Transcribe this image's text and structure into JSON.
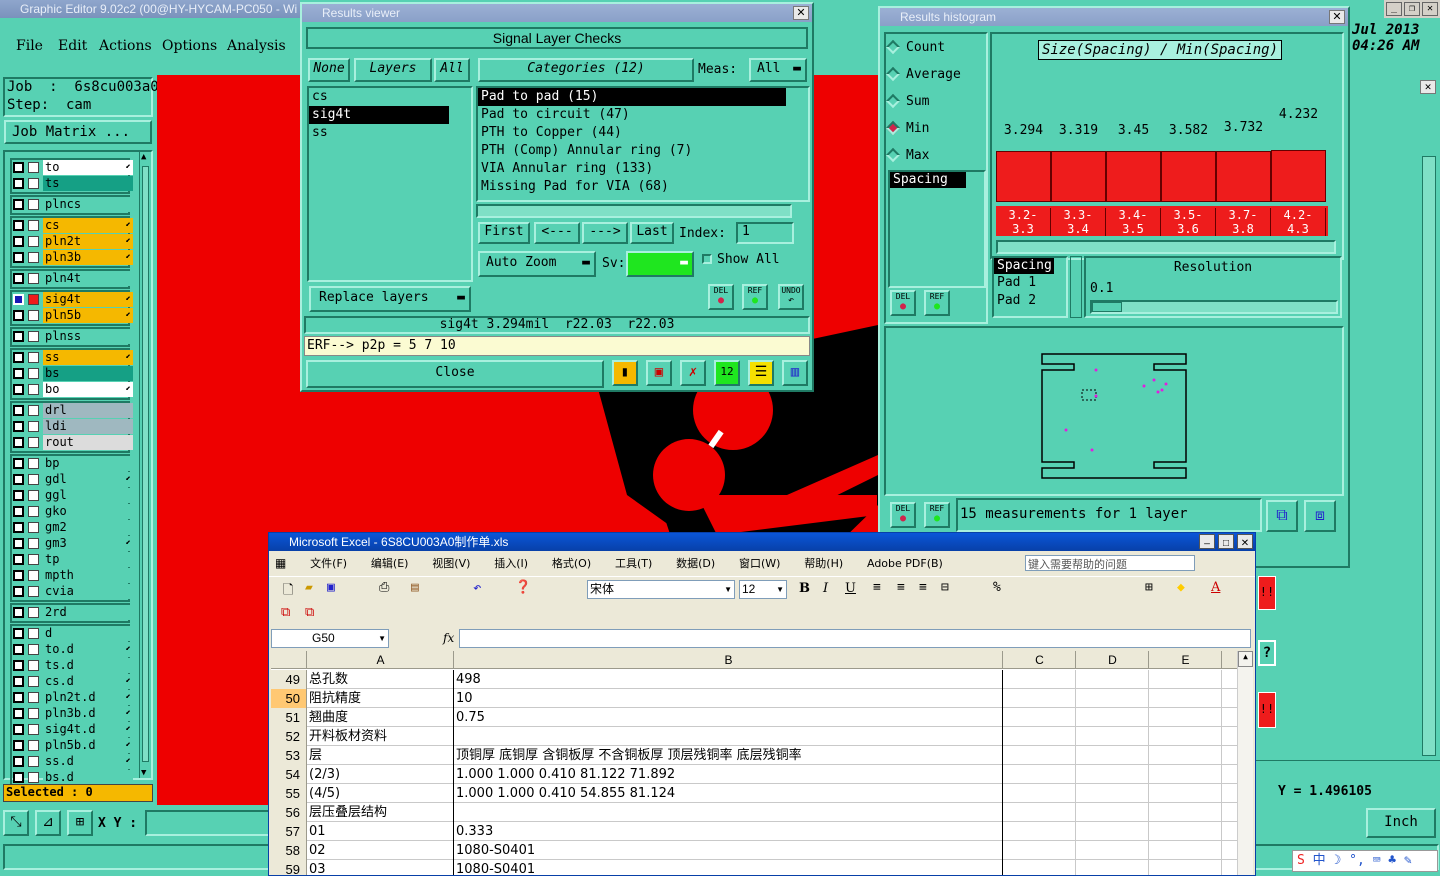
{
  "app": {
    "title": "Graphic Editor 9.02c2 (00@HY-HYCAM-PC050 - Wi",
    "datetime": "Jul 2013",
    "time": "04:26 AM",
    "menu": [
      "File",
      "Edit",
      "Actions",
      "Options",
      "Analysis"
    ],
    "job_label": "Job  :  6s8cu003a0",
    "step_label": "Step:  cam",
    "job_matrix": "Job Matrix ...",
    "selected": "Selected : 0",
    "xy_label": "X Y :",
    "units": "Inch",
    "coord_readout": "Y = 1.496105",
    "layers": [
      {
        "name": "to",
        "color": "#ffffff",
        "arrow": true
      },
      {
        "name": "ts",
        "color": "#15a085",
        "arrow": false
      },
      {
        "name": "plncs",
        "color": "#57d1b3",
        "arrow": false
      },
      {
        "name": "cs",
        "color": "#f5b800",
        "arrow": true
      },
      {
        "name": "pln2t",
        "color": "#f5b800",
        "arrow": true
      },
      {
        "name": "pln3b",
        "color": "#f5b800",
        "arrow": true
      },
      {
        "name": "pln4t",
        "color": "#57d1b3",
        "arrow": false
      },
      {
        "name": "sig4t",
        "color": "#f5b800",
        "arrow": true
      },
      {
        "name": "pln5b",
        "color": "#f5b800",
        "arrow": true
      },
      {
        "name": "plnss",
        "color": "#57d1b3",
        "arrow": false
      },
      {
        "name": "ss",
        "color": "#f5b800",
        "arrow": true
      },
      {
        "name": "bs",
        "color": "#15a085",
        "arrow": false
      },
      {
        "name": "bo",
        "color": "#ffffff",
        "arrow": true
      },
      {
        "name": "drl",
        "color": "#9fb8c0",
        "arrow": false
      },
      {
        "name": "ldi",
        "color": "#9fb8c0",
        "arrow": false
      },
      {
        "name": "rout",
        "color": "#dcdcdc",
        "arrow": false
      },
      {
        "name": "bp",
        "color": "#57d1b3",
        "arrow": false
      },
      {
        "name": "gdl",
        "color": "#57d1b3",
        "arrow": true
      },
      {
        "name": "ggl",
        "color": "#57d1b3",
        "arrow": false
      },
      {
        "name": "gko",
        "color": "#57d1b3",
        "arrow": false
      },
      {
        "name": "gm2",
        "color": "#57d1b3",
        "arrow": false
      },
      {
        "name": "gm3",
        "color": "#57d1b3",
        "arrow": true
      },
      {
        "name": "tp",
        "color": "#57d1b3",
        "arrow": false
      },
      {
        "name": "mpth",
        "color": "#57d1b3",
        "arrow": false
      },
      {
        "name": "cvia",
        "color": "#57d1b3",
        "arrow": false
      },
      {
        "name": "2rd",
        "color": "#57d1b3",
        "arrow": false
      },
      {
        "name": "d",
        "color": "#57d1b3",
        "arrow": false
      },
      {
        "name": "to.d",
        "color": "#57d1b3",
        "arrow": true
      },
      {
        "name": "ts.d",
        "color": "#57d1b3",
        "arrow": false
      },
      {
        "name": "cs.d",
        "color": "#57d1b3",
        "arrow": true
      },
      {
        "name": "pln2t.d",
        "color": "#57d1b3",
        "arrow": true
      },
      {
        "name": "pln3b.d",
        "color": "#57d1b3",
        "arrow": true
      },
      {
        "name": "sig4t.d",
        "color": "#57d1b3",
        "arrow": true
      },
      {
        "name": "pln5b.d",
        "color": "#57d1b3",
        "arrow": true
      },
      {
        "name": "ss.d",
        "color": "#57d1b3",
        "arrow": true
      },
      {
        "name": "bs.d",
        "color": "#57d1b3",
        "arrow": false
      }
    ]
  },
  "results_viewer": {
    "title": "Results viewer",
    "header": "Signal Layer Checks",
    "none_btn": "None",
    "layers_btn": "Layers",
    "all_btn": "All",
    "categories_btn": "Categories (12)",
    "meas_label": "Meas:",
    "meas_value": "All",
    "layers": [
      "cs",
      "sig4t",
      "ss"
    ],
    "categories": [
      "Pad to pad (15)",
      "Pad to circuit (47)",
      "PTH to Copper (44)",
      "PTH (Comp) Annular ring (7)",
      "VIA Annular ring (133)",
      "Missing Pad for VIA (68)"
    ],
    "first_btn": "First",
    "prev_btn": "<---",
    "next_btn": "--->",
    "last_btn": "Last",
    "index_label": "Index:",
    "index_value": "1",
    "auto_zoom": "Auto Zoom",
    "sv_label": "Sv:",
    "show_all": "Show All",
    "replace_layers": "Replace layers",
    "del": "DEL",
    "ref": "REF",
    "undo": "UNDO",
    "status": "sig4t 3.294mil  r22.03  r22.03",
    "erf": "ERF--> p2p = 5 7 10",
    "close": "Close"
  },
  "histogram": {
    "title": "Results histogram",
    "stats": [
      "Count",
      "Average",
      "Sum",
      "Min",
      "Max"
    ],
    "selected_stat": "Min",
    "measure_list": [
      "Spacing"
    ],
    "chart_title": "Size(Spacing) / Min(Spacing)",
    "chart_data": {
      "type": "bar",
      "categories": [
        "3.2-3.3",
        "3.3-3.4",
        "3.4-3.5",
        "3.5-3.6",
        "3.7-3.8",
        "4.2-4.3"
      ],
      "values": [
        3.294,
        3.319,
        3.45,
        3.582,
        3.732,
        4.232
      ],
      "labels": [
        "3.294",
        "3.319",
        "3.45",
        "3.582",
        "3.732",
        "4.232"
      ],
      "range_top": [
        "3.2-",
        "3.3-",
        "3.4-",
        "3.5-",
        "3.7-",
        "4.2-"
      ],
      "range_bottom": [
        "3.3",
        "3.4",
        "3.5",
        "3.6",
        "3.8",
        "4.3"
      ]
    },
    "sort_list": [
      "Spacing",
      "Pad 1",
      "Pad 2"
    ],
    "resolution_label": "Resolution",
    "resolution_value": "0.1",
    "measurements": "15 measurements for 1 layer",
    "del": "DEL",
    "ref": "REF"
  },
  "excel": {
    "title": "Microsoft Excel - 6S8CU003A0制作单.xls",
    "menu": [
      "文件(F)",
      "编辑(E)",
      "视图(V)",
      "插入(I)",
      "格式(O)",
      "工具(T)",
      "数据(D)",
      "窗口(W)",
      "帮助(H)",
      "Adobe PDF(B)"
    ],
    "help_placeholder": "键入需要帮助的问题",
    "font_name": "宋体",
    "font_size": "12",
    "cell_ref": "G50",
    "fx": "fx",
    "columns": [
      "A",
      "B",
      "C",
      "D",
      "E"
    ],
    "rows": [
      {
        "n": "49",
        "a": "总孔数",
        "b": "498"
      },
      {
        "n": "50",
        "a": "阻抗精度",
        "b": "10"
      },
      {
        "n": "51",
        "a": "翘曲度",
        "b": "0.75"
      },
      {
        "n": "52",
        "a": "开料板材资料",
        "b": ""
      },
      {
        "n": "53",
        "a": "层",
        "b": "顶铜厚  底铜厚  含铜板厚  不含铜板厚  顶层残铜率  底层残铜率"
      },
      {
        "n": "54",
        "a": "(2/3)",
        "b": "1.000   1.000          0.410       81.122  71.892"
      },
      {
        "n": "55",
        "a": "(4/5)",
        "b": "1.000   1.000          0.410       54.855  81.124"
      },
      {
        "n": "56",
        "a": "层压叠层结构",
        "b": ""
      },
      {
        "n": "57",
        "a": "01",
        "b": "0.333"
      },
      {
        "n": "58",
        "a": "02",
        "b": "1080-S0401"
      },
      {
        "n": "59",
        "a": "03",
        "b": "1080-S0401"
      }
    ]
  }
}
